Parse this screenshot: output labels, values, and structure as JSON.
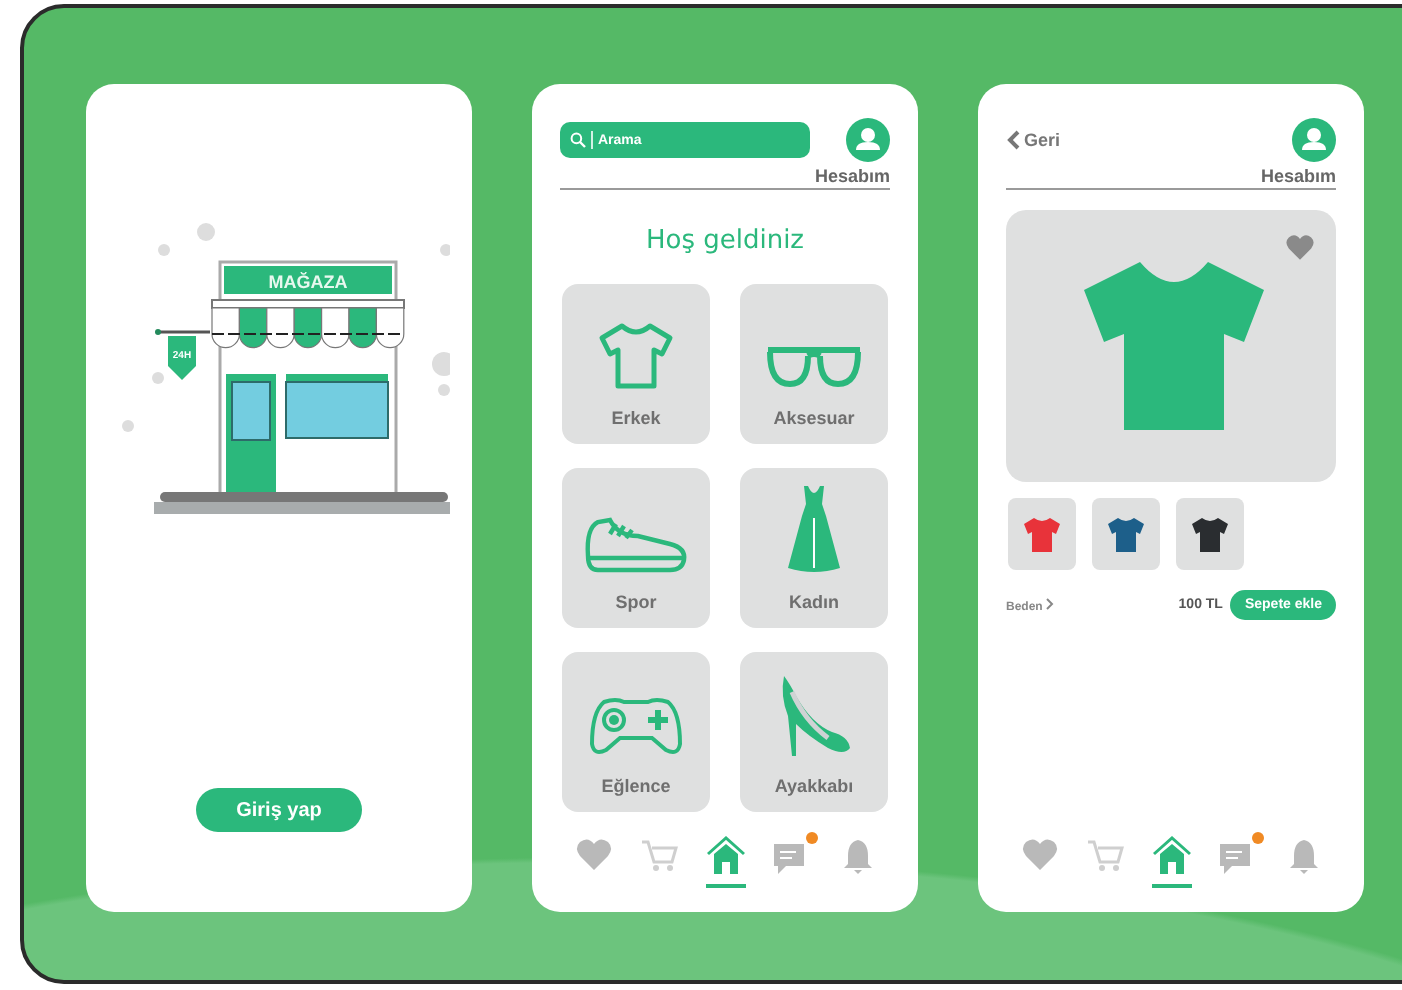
{
  "login_screen": {
    "store_sign": "MAĞAZA",
    "hanging_sign": "24H",
    "login_button": "Giriş yap"
  },
  "home_screen": {
    "search": {
      "placeholder": "Arama"
    },
    "account_label": "Hesabım",
    "greeting": "Hoş geldiniz",
    "categories": [
      {
        "label": "Erkek",
        "kind": "tshirt"
      },
      {
        "label": "Aksesuar",
        "kind": "glasses"
      },
      {
        "label": "Spor",
        "kind": "sneaker"
      },
      {
        "label": "Kadın",
        "kind": "dress"
      },
      {
        "label": "Eğlence",
        "kind": "gamepad"
      },
      {
        "label": "Ayakkabı",
        "kind": "heels"
      }
    ],
    "nav": [
      {
        "kind": "heart",
        "selected": false,
        "notification": false
      },
      {
        "kind": "cart",
        "selected": false,
        "notification": false
      },
      {
        "kind": "home",
        "selected": true,
        "notification": false
      },
      {
        "kind": "chat",
        "selected": false,
        "notification": true
      },
      {
        "kind": "bell",
        "selected": false,
        "notification": false
      }
    ]
  },
  "product_screen": {
    "back": "Geri",
    "account_label": "Hesabım",
    "variants": [
      {
        "color": "#e8333a"
      },
      {
        "color": "#1d5f8a"
      },
      {
        "color": "#2a2d30"
      }
    ],
    "size_label": "Beden",
    "price": "100 TL",
    "add_to_cart_button": "Sepete ekle",
    "nav": [
      {
        "kind": "heart",
        "selected": false,
        "notification": false
      },
      {
        "kind": "cart",
        "selected": false,
        "notification": false
      },
      {
        "kind": "home",
        "selected": true,
        "notification": false
      },
      {
        "kind": "chat",
        "selected": false,
        "notification": true
      },
      {
        "kind": "bell",
        "selected": false,
        "notification": false
      }
    ]
  }
}
